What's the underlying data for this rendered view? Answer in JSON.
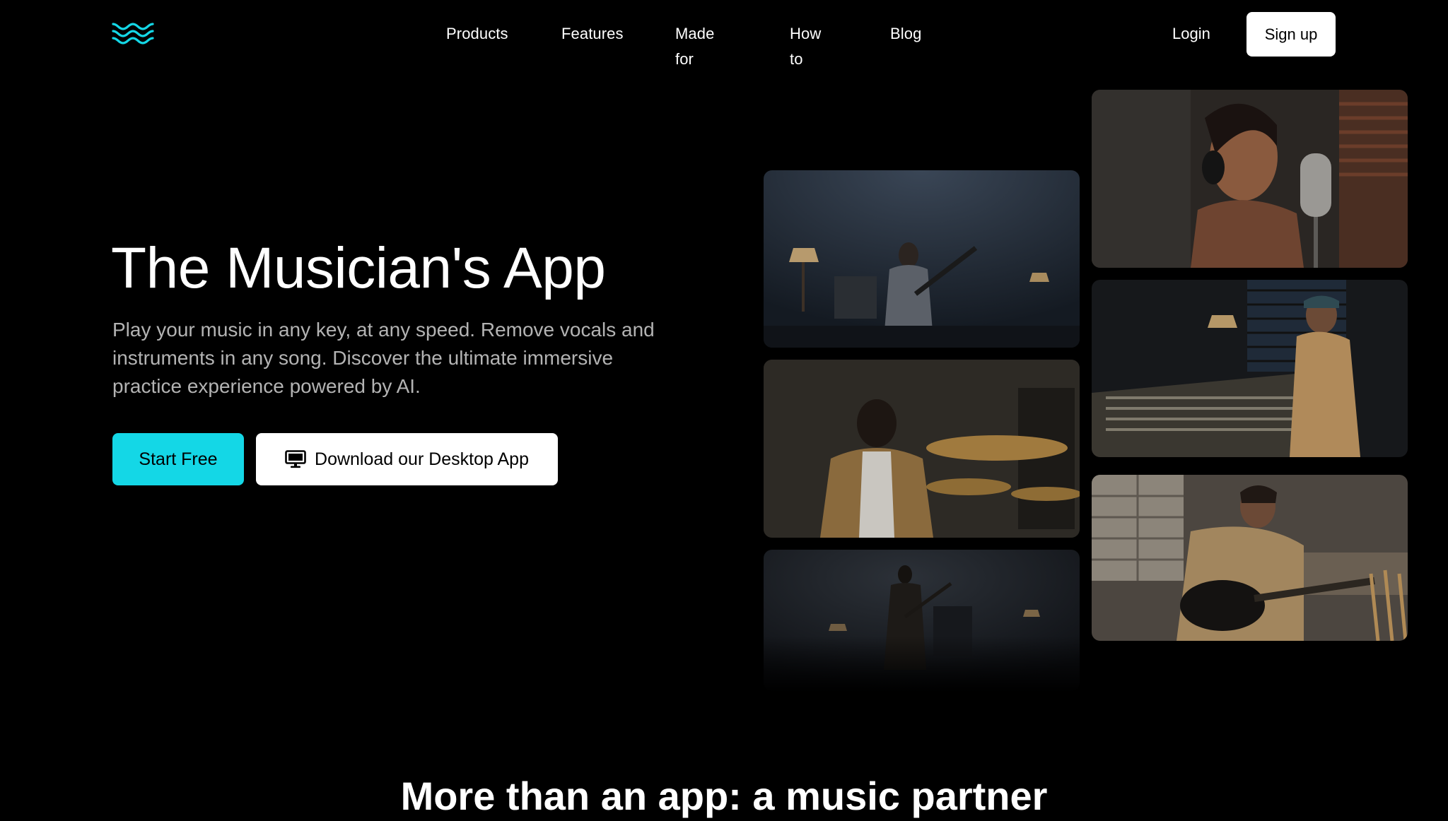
{
  "nav": {
    "logo_icon": "wave-logo-icon",
    "links": [
      "Products",
      "Features",
      "Made for",
      "How to",
      "Blog"
    ],
    "login_label": "Login",
    "signup_label": "Sign up"
  },
  "hero": {
    "title": "The Musician's App",
    "subtitle": "Play your music in any key, at any speed. Remove vocals and instruments in any song. Discover the ultimate immersive practice experience powered by AI.",
    "start_label": "Start Free",
    "download_label": "Download our Desktop App",
    "download_icon": "monitor-icon"
  },
  "section": {
    "title": "More than an app: a music partner"
  },
  "colors": {
    "accent": "#14d7e6",
    "background": "#000000",
    "subtitle_text": "#b3b3b3"
  }
}
